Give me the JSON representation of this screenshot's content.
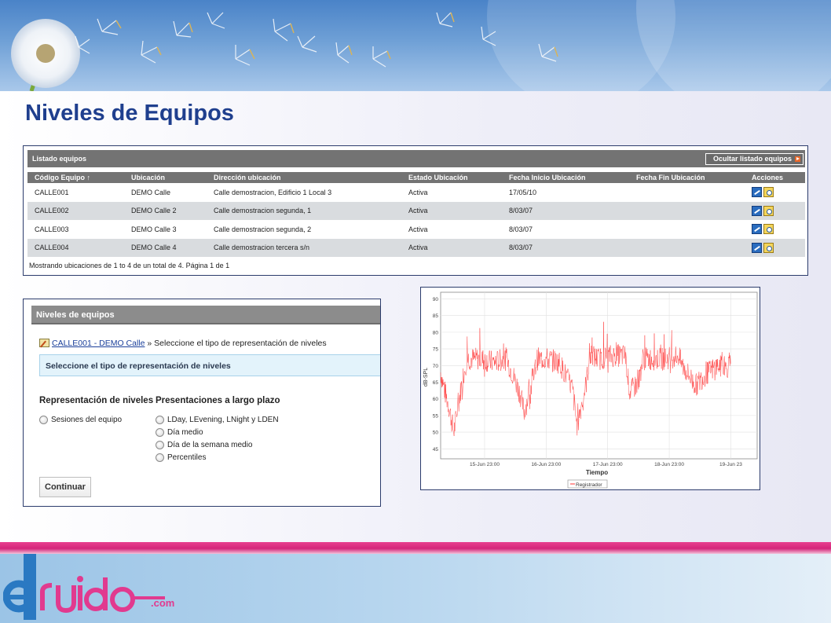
{
  "page": {
    "title": "Niveles de Equipos"
  },
  "listado": {
    "title": "Listado equipos",
    "hide_button": "Ocultar listado equipos",
    "columns": [
      "Código Equipo ↑",
      "Ubicación",
      "Dirección ubicación",
      "Estado Ubicación",
      "Fecha Inicio Ubicación",
      "Fecha Fin Ubicación",
      "Acciones"
    ],
    "rows": [
      {
        "codigo": "CALLE001",
        "ubicacion": "DEMO Calle",
        "direccion": "Calle demostracion, Edificio 1 Local 3",
        "estado": "Activa",
        "inicio": "17/05/10",
        "fin": ""
      },
      {
        "codigo": "CALLE002",
        "ubicacion": "DEMO Calle 2",
        "direccion": "Calle demostracion segunda, 1",
        "estado": "Activa",
        "inicio": "8/03/07",
        "fin": ""
      },
      {
        "codigo": "CALLE003",
        "ubicacion": "DEMO Calle 3",
        "direccion": "Calle demostracion segunda, 2",
        "estado": "Activa",
        "inicio": "8/03/07",
        "fin": ""
      },
      {
        "codigo": "CALLE004",
        "ubicacion": "DEMO Calle 4",
        "direccion": "Calle demostracion tercera s/n",
        "estado": "Activa",
        "inicio": "8/03/07",
        "fin": ""
      }
    ],
    "footer": "Mostrando ubicaciones de 1 to 4 de un total de 4. Página 1 de 1"
  },
  "niveles": {
    "title": "Niveles de equipos",
    "breadcrumb_link": "CALLE001 - DEMO Calle",
    "breadcrumb_sep": "»",
    "breadcrumb_text": "Seleccione el tipo de representación de niveles",
    "info": "Seleccione el tipo de representación de niveles",
    "col1_header": "Representación de niveles",
    "col2_header": "Presentaciones a largo plazo",
    "col1_options": [
      "Sesiones del equipo"
    ],
    "col2_options": [
      "LDay, LEvening, LNight y LDEN",
      "Día medio",
      "Día de la semana medio",
      "Percentiles"
    ],
    "continue_button": "Continuar"
  },
  "chart_data": {
    "type": "line",
    "title": "",
    "xlabel": "Tiempo",
    "ylabel": "dB-SPL",
    "ylim": [
      42,
      92
    ],
    "yticks": [
      45,
      50,
      55,
      60,
      65,
      70,
      75,
      80,
      85,
      90
    ],
    "x_tick_labels": [
      "15-Jun 23:00",
      "16-Jun 23:00",
      "17-Jun 23:00",
      "18-Jun 23:00",
      "19-Jun 23"
    ],
    "grid": true,
    "legend": "bottom-center",
    "series": [
      {
        "name": "Registrador",
        "color": "#ff3333",
        "x_hours_from_start": [
          0,
          2,
          4,
          6,
          8,
          10,
          12,
          14,
          18,
          24,
          30,
          36,
          38,
          42,
          44,
          48,
          54,
          60,
          62,
          66,
          68,
          72,
          78,
          84,
          86,
          90,
          92,
          96,
          102,
          108,
          110,
          114,
          116,
          120,
          126,
          130,
          132
        ],
        "values": [
          68,
          62,
          57,
          50,
          58,
          66,
          72,
          72,
          72,
          71,
          72,
          62,
          56,
          66,
          72,
          72,
          71,
          63,
          52,
          64,
          73,
          72,
          73,
          73,
          62,
          65,
          72,
          72,
          72,
          73,
          70,
          66,
          64,
          67,
          70,
          69,
          71
        ]
      }
    ]
  },
  "logo": {
    "text": "elruido",
    "domain": ".com"
  },
  "colors": {
    "title": "#1f3f8e",
    "stripe": "#e83f8f",
    "grid_header": "#737373"
  }
}
